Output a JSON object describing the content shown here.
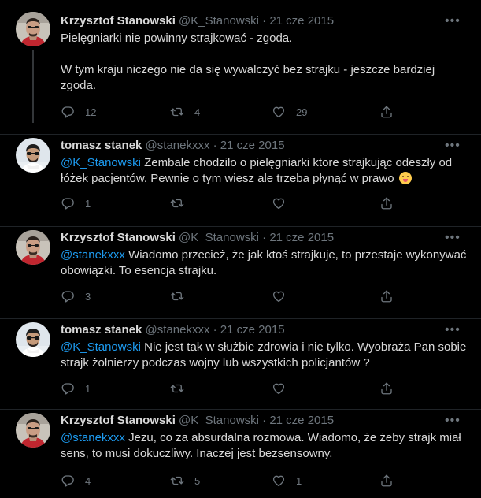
{
  "tweets": [
    {
      "author": "Krzysztof Stanowski",
      "handle": "@K_Stanowski",
      "date": "· 21 cze 2015",
      "paragraphs": [
        "Pielęgniarki nie powinny strajkować - zgoda.",
        "W tym kraju niczego nie da się wywalczyć bez strajku - jeszcze bardziej zgoda."
      ],
      "reply_count": "12",
      "retweet_count": "4",
      "like_count": "29"
    },
    {
      "author": "tomasz stanek",
      "handle": "@stanekxxx",
      "date": "· 21 cze 2015",
      "mention": "@K_Stanowski",
      "body": " Zembale chodziło o pielęgniarki ktore strajkując odeszły od łóżek pacjentów. Pewnie o tym wiesz ale trzeba płynąć w prawo",
      "reply_count": "1",
      "retweet_count": "",
      "like_count": ""
    },
    {
      "author": "Krzysztof Stanowski",
      "handle": "@K_Stanowski",
      "date": "· 21 cze 2015",
      "mention": "@stanekxxx",
      "body": " Wiadomo przecież, że jak ktoś strajkuje, to przestaje wykonywać obowiązki. To esencja strajku.",
      "reply_count": "3",
      "retweet_count": "",
      "like_count": ""
    },
    {
      "author": "tomasz stanek",
      "handle": "@stanekxxx",
      "date": "· 21 cze 2015",
      "mention": "@K_Stanowski",
      "body": " Nie jest tak w służbie zdrowia i nie tylko. Wyobraża Pan sobie strajk żołnierzy podczas wojny lub wszystkich policjantów ?",
      "reply_count": "1",
      "retweet_count": "",
      "like_count": ""
    },
    {
      "author": "Krzysztof Stanowski",
      "handle": "@K_Stanowski",
      "date": "· 21 cze 2015",
      "mention": "@stanekxxx",
      "body": " Jezu, co za absurdalna rozmowa. Wiadomo, że żeby strajk miał sens, to musi dokuczliwy. Inaczej jest bezsensowny.",
      "reply_count": "4",
      "retweet_count": "5",
      "like_count": "1"
    }
  ],
  "icons": {
    "more": "more-horizontal-icon",
    "reply": "reply-icon",
    "retweet": "retweet-icon",
    "like": "heart-icon",
    "share": "share-icon",
    "emoji": "face-with-tongue-emoji"
  },
  "colors": {
    "background": "#000000",
    "text": "#d9d9d9",
    "muted": "#6e767d",
    "link": "#1d9bf0"
  }
}
